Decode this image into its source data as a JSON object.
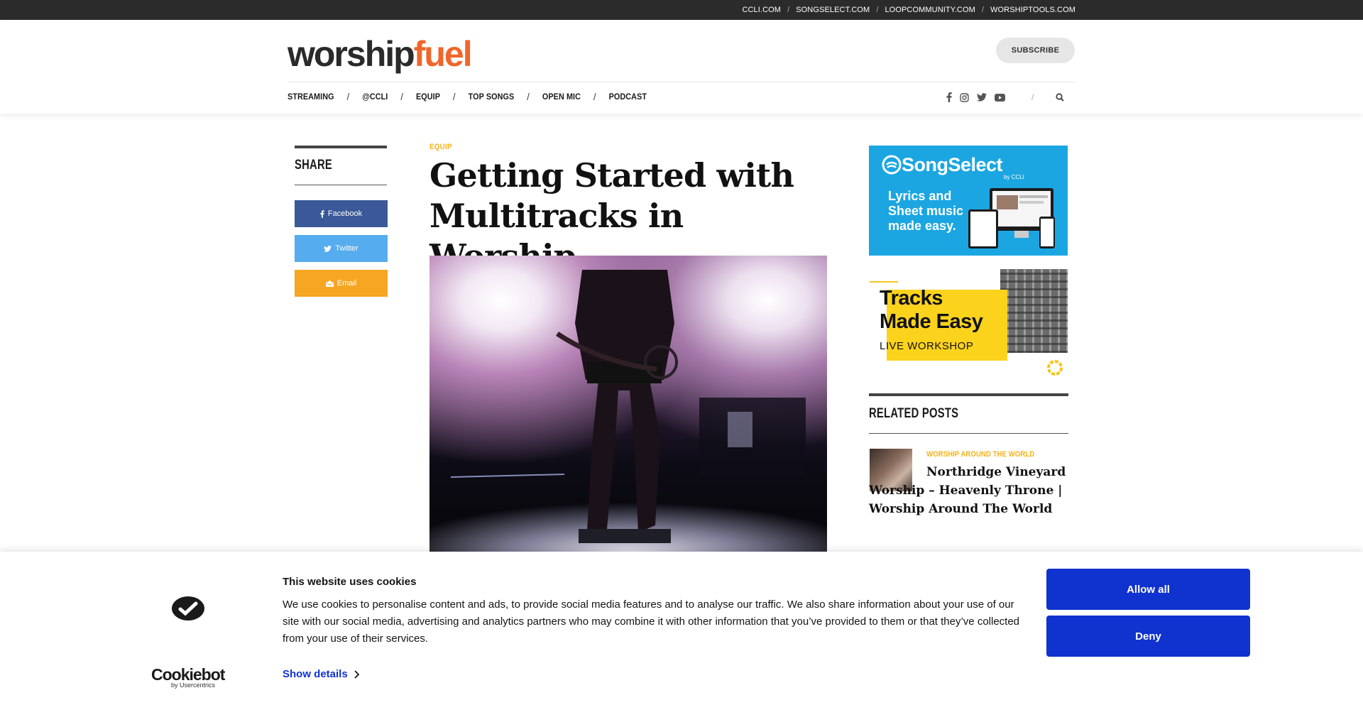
{
  "topbar": {
    "links": [
      "CCLI.COM",
      "SONGSELECT.COM",
      "LOOPCOMMUNITY.COM",
      "WORSHIPTOOLS.COM"
    ],
    "separator": "/"
  },
  "header": {
    "logo_part1": "worship",
    "logo_part2": "fuel",
    "subscribe_label": "SUBSCRIBE",
    "nav": [
      "STREAMING",
      "@CCLI",
      "EQUIP",
      "TOP SONGS",
      "OPEN MIC",
      "PODCAST"
    ],
    "nav_separator": "/",
    "social_separator": "/",
    "social_icons": [
      "facebook-icon",
      "instagram-icon",
      "twitter-icon",
      "youtube-icon",
      "search-icon"
    ]
  },
  "share": {
    "title": "SHARE",
    "facebook_label": "Facebook",
    "twitter_label": "Twitter",
    "email_label": "Email"
  },
  "article": {
    "category": "EQUIP",
    "title": "Getting Started with Multitracks in Worship"
  },
  "sidebar": {
    "ad1": {
      "brand": "SongSelect",
      "brand_sub": "by CCLI",
      "tagline_lines": [
        "Lyrics and",
        "Sheet music",
        "made easy."
      ]
    },
    "ad2": {
      "headline_lines": [
        "Tracks",
        "Made Easy"
      ],
      "subline": "LIVE WORKSHOP"
    },
    "related": {
      "title": "RELATED POSTS",
      "items": [
        {
          "category": "WORSHIP AROUND THE WORLD",
          "title": "Northridge Vineyard Worship – Heavenly Throne | Worship Around The World"
        }
      ]
    }
  },
  "cookie": {
    "title": "This website uses cookies",
    "body": "We use cookies to personalise content and ads, to provide social media features and to analyse our traffic. We also share information about your use of our site with our social media, advertising and analytics partners who may combine it with other information that you’ve provided to them or that they’ve collected from your use of their services.",
    "details_label": "Show details",
    "allow_label": "Allow all",
    "deny_label": "Deny",
    "brand": "Cookiebot",
    "brand_sub": "by Usercentrics"
  },
  "colors": {
    "accent_orange": "#f0662a",
    "category_yellow": "#f6b31a",
    "facebook": "#3b5998",
    "twitter": "#55acee",
    "email": "#f6a623",
    "cookie_button": "#1032cf",
    "songselect_blue": "#1ba6e2"
  }
}
